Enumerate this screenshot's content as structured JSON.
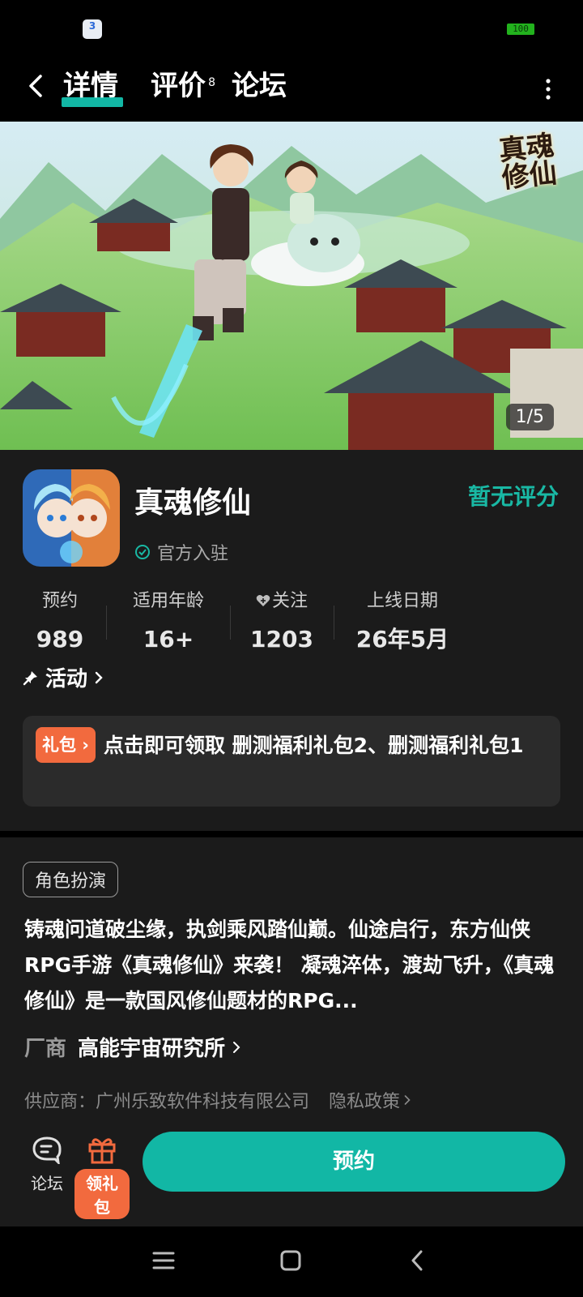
{
  "status_bar": {
    "app_icon_text": "3",
    "battery": "100"
  },
  "header": {
    "tabs": [
      {
        "label": "详情",
        "active": true
      },
      {
        "label": "评价",
        "count": "8"
      },
      {
        "label": "论坛"
      }
    ],
    "icons": [
      "back-icon",
      "more-icon"
    ]
  },
  "banner": {
    "logo_text": "真魂修仙",
    "page_indicator": "1/5"
  },
  "game": {
    "title": "真魂修仙",
    "rating": "暂无评分",
    "verified_label": "官方入驻",
    "stats": [
      {
        "label": "预约",
        "value": "989"
      },
      {
        "label": "适用年龄",
        "value": "16+"
      },
      {
        "label": "关注",
        "value": "1203"
      },
      {
        "label": "上线日期",
        "value": "26年5月"
      }
    ]
  },
  "activity": {
    "title": "活动",
    "badge": "礼包",
    "text": "点击即可领取 删测福利礼包2、删测福利礼包1"
  },
  "description": {
    "genre": "角色扮演",
    "text": "铸魂问道破尘缘，执剑乘风踏仙巅。仙途启行，东方仙侠 RPG手游《真魂修仙》来袭！ 凝魂淬体，渡劫飞升，《真魂修仙》是一款国风修仙题材的RPG...",
    "vendor_label": "厂商",
    "vendor_name": "高能宇宙研究所",
    "supplier": "供应商：广州乐致软件科技有限公司",
    "privacy": "隐私政策"
  },
  "bottom_bar": {
    "forum_label": "论坛",
    "gift_label": "领礼包",
    "reserve_label": "预约"
  },
  "colors": {
    "accent": "#12b7a5",
    "gift": "#f26a3e",
    "background": "#1b1b1b"
  }
}
